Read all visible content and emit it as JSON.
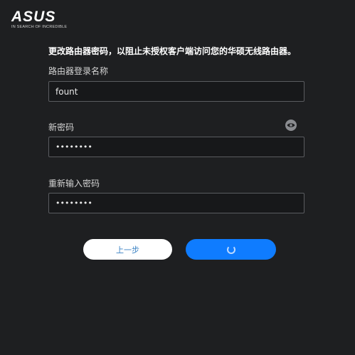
{
  "brand": {
    "logo_text": "ASUS",
    "tagline": "IN SEARCH OF INCREDIBLE"
  },
  "instruction": "更改路由器密码，以阻止未授权客户端访问您的华硕无线路由器。",
  "form": {
    "login_name": {
      "label": "路由器登录名称",
      "value": "fount"
    },
    "new_password": {
      "label": "新密码",
      "value": "••••••••",
      "toggle_icon": "eye-icon"
    },
    "confirm_password": {
      "label": "重新输入密码",
      "value": "••••••••"
    }
  },
  "buttons": {
    "back_label": "上一步",
    "next_state": "loading"
  },
  "colors": {
    "background": "#1e1f21",
    "primary": "#0f7cff",
    "field_border": "#5a5c60"
  }
}
